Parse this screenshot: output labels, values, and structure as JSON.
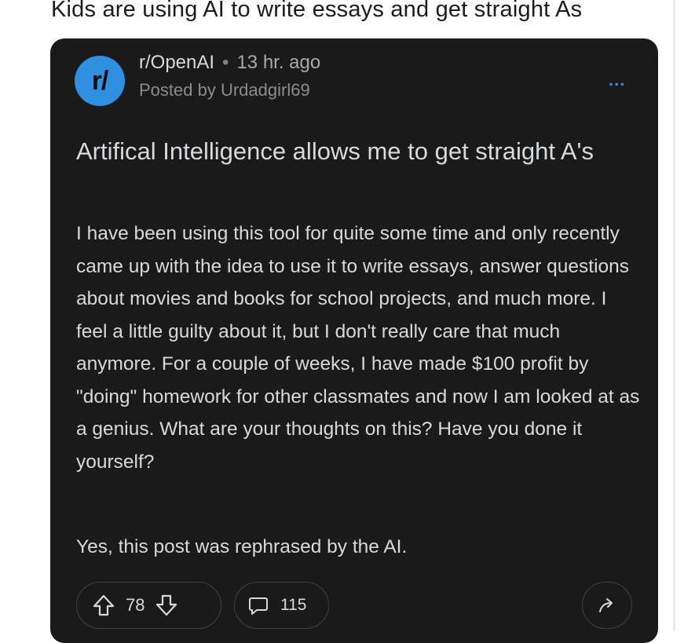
{
  "headline": "Kids are using AI to write essays and get straight As",
  "post": {
    "avatar_text": "r/",
    "subreddit": "r/OpenAI",
    "separator": "•",
    "time": "13 hr. ago",
    "posted_by": "Posted by Urdadgirl69",
    "more_label": "...",
    "title": "Artifical Intelligence allows me to get straight A's",
    "body": "I have been using this tool for quite some time and only recently came up with the idea to use it to write essays, answer questions about movies and books for school projects, and much more. I feel a little guilty about it, but I don't really care that much anymore. For a couple of weeks, I have made $100 profit by \"doing\" homework for other classmates and now I am looked at as a genius. What are your thoughts on this? Have you done it yourself?",
    "postscript": "Yes, this post was rephrased by the AI.",
    "vote_count": "78",
    "comment_count": "115"
  },
  "icons": {
    "upvote": "upvote-arrow-icon",
    "downvote": "downvote-arrow-icon",
    "comment": "comment-bubble-icon",
    "share": "share-arrow-icon",
    "more": "more-dots-icon"
  },
  "colors": {
    "card_background": "#1a1a1b",
    "text": "#d7dadc",
    "muted_text": "#8a8c8e",
    "avatar": "#2f8fe0",
    "accent": "#3d8ee4"
  }
}
